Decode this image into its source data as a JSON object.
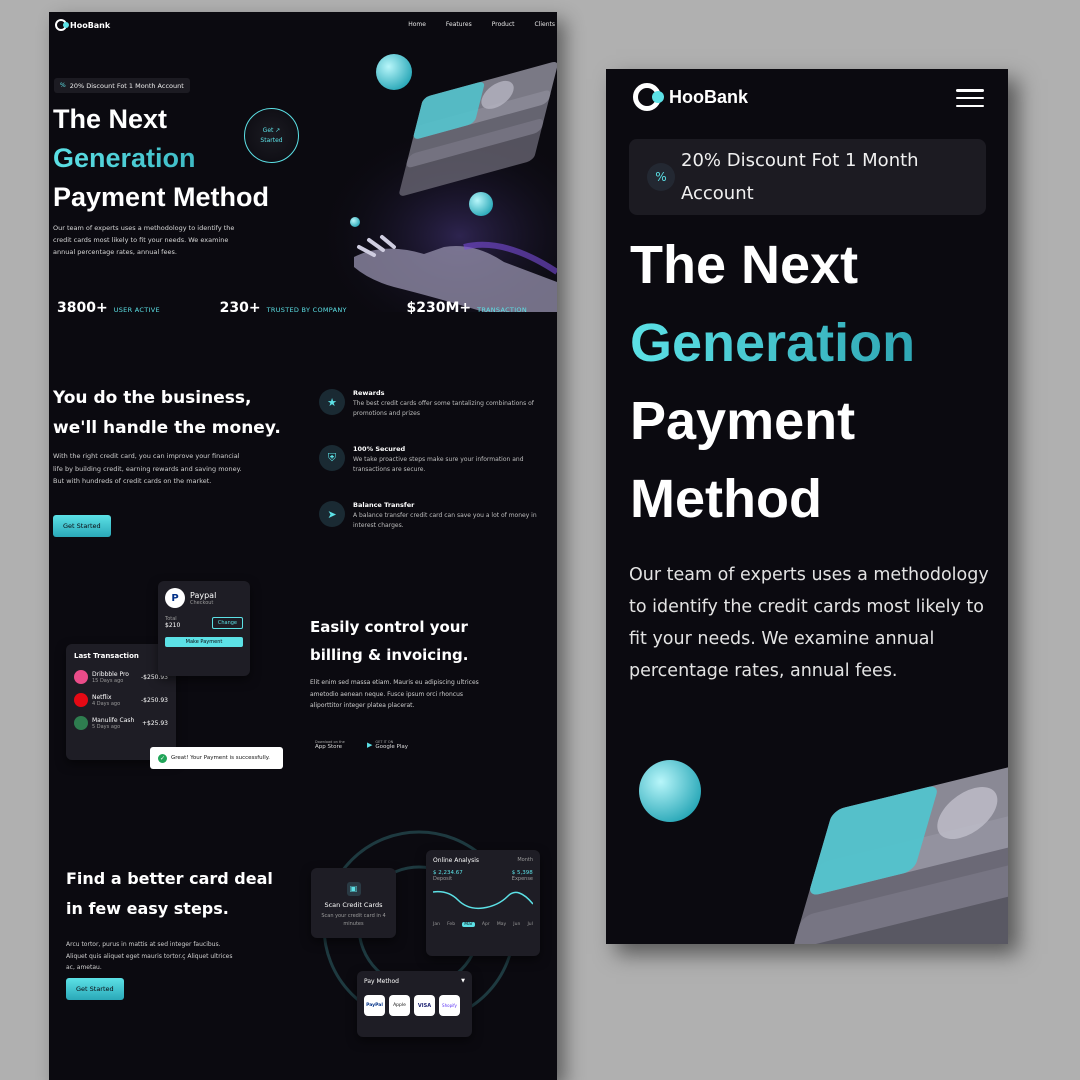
{
  "brand": {
    "name": "HooBank",
    "accent": "#5ce1e6",
    "background": "#0b0a10"
  },
  "nav": {
    "items": [
      "Home",
      "Features",
      "Product",
      "Clients"
    ]
  },
  "hero": {
    "discount": "20% Discount Fot 1 Month Account",
    "line1": "The Next",
    "line2": "Generation",
    "line3": "Payment Method",
    "line3a": "Payment",
    "line3b": "Method",
    "cta_line1": "Get",
    "cta_line2": "Started",
    "description": "Our team of experts uses a methodology to identify the credit cards most likely to fit your needs. We examine annual percentage rates, annual fees."
  },
  "stats": [
    {
      "value": "3800+",
      "label": "USER ACTIVE"
    },
    {
      "value": "230+",
      "label": "TRUSTED BY COMPANY"
    },
    {
      "value": "$230M+",
      "label": "TRANSACTION"
    }
  ],
  "business": {
    "title1": "You do the business,",
    "title2": "we'll handle the money.",
    "text": "With the right credit card, you can improve your financial life by building credit, earning rewards and saving money. But with hundreds of credit cards on the market.",
    "button": "Get Started",
    "features": [
      {
        "title": "Rewards",
        "text": "The best credit cards offer some tantalizing combinations of promotions and prizes"
      },
      {
        "title": "100% Secured",
        "text": "We take proactive steps make sure your information and transactions are secure."
      },
      {
        "title": "Balance Transfer",
        "text": "A balance transfer credit card can save you a lot of money in interest charges."
      }
    ]
  },
  "billing": {
    "title1": "Easily control your",
    "title2": "billing & invoicing.",
    "text": "Elit enim sed massa etiam. Mauris eu adipiscing ultrices ametodio aenean neque. Fusce ipsum orci rhoncus aliporttitor integer platea placerat.",
    "appstore_small": "Download on the",
    "appstore": "App Store",
    "googleplay_small": "GET IT ON",
    "googleplay": "Google Play",
    "paypal": {
      "title": "Paypal",
      "subtitle": "Checkout",
      "total_label": "Total",
      "total": "$210",
      "change": "Change",
      "button": "Make Payment"
    },
    "last_transaction": {
      "title": "Last Transaction",
      "rows": [
        {
          "name": "Dribbble Pro",
          "when": "15 Days ago",
          "amount": "-$250.93"
        },
        {
          "name": "Netflix",
          "when": "4 Days ago",
          "amount": "-$250.93"
        },
        {
          "name": "Manulife Cash",
          "when": "5 Days ago",
          "amount": "+$25.93"
        }
      ]
    },
    "toast": "Great! Your Payment is successfully."
  },
  "steps": {
    "title1": "Find a better card deal",
    "title2": "in few easy steps.",
    "text": "Arcu tortor, purus in mattis at sed integer faucibus. Aliquet quis aliquet eget mauris tortor.ç Aliquet ultrices ac, ametau.",
    "button": "Get Started",
    "scan": {
      "title": "Scan Credit Cards",
      "text": "Scan your credit card in 4 minutes"
    },
    "analysis": {
      "title": "Online Analysis",
      "period": "Month",
      "income": "$ 2,234.67",
      "income_label": "Deposit",
      "expense": "$ 5,398",
      "expense_label": "Expense",
      "months": [
        "Jan",
        "Feb",
        "Mar",
        "Apr",
        "May",
        "Jun",
        "Jul"
      ],
      "selected": "Mar"
    },
    "pay_method": {
      "title": "Pay Method",
      "methods": [
        "PayPal",
        "Apple",
        "VISA",
        "Shopify"
      ]
    }
  }
}
